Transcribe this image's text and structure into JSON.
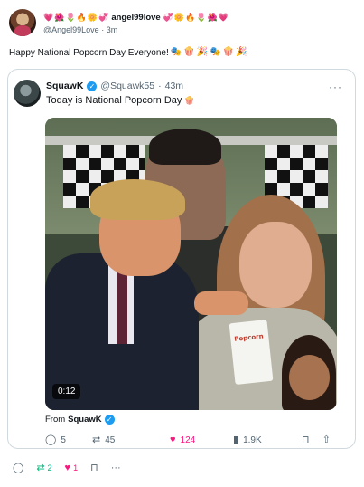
{
  "post": {
    "avatar_icon": "user-avatar",
    "name_emojis_left": [
      "💗",
      "🌺",
      "🌷",
      "🔥",
      "🌼",
      "💞"
    ],
    "display_name": "angel99love",
    "name_emojis_right": [
      "💞",
      "🌼",
      "🔥",
      "🌷",
      "🌺",
      "💗"
    ],
    "handle": "@Angel99Love",
    "time": "3m",
    "text": "Happy National Popcorn Day Everyone!",
    "text_emojis": [
      "🎭",
      "🍿",
      "🎉",
      "🎭",
      "🍿",
      "🎉"
    ]
  },
  "quote": {
    "display_name": "SquawK",
    "handle": "@Squawk55",
    "time": "43m",
    "text": "Today is National Popcorn Day",
    "text_emoji": "🍿",
    "video_duration": "0:12",
    "popcorn_bag_label": "Popcorn",
    "from_prefix": "From",
    "from_account": "SquawK",
    "metrics": {
      "replies": "5",
      "retweets": "45",
      "likes": "124",
      "views": "1.9K"
    }
  },
  "actions": {
    "retweets": "2",
    "likes": "1"
  },
  "colors": {
    "verified": "#1d9bf0",
    "like": "#f91880",
    "retweet": "#00ba7c",
    "muted": "#536471"
  },
  "icons": [
    "reply-icon",
    "retweet-icon",
    "heart-icon",
    "views-icon",
    "bookmark-icon",
    "share-icon",
    "more-icon",
    "verified-icon"
  ]
}
